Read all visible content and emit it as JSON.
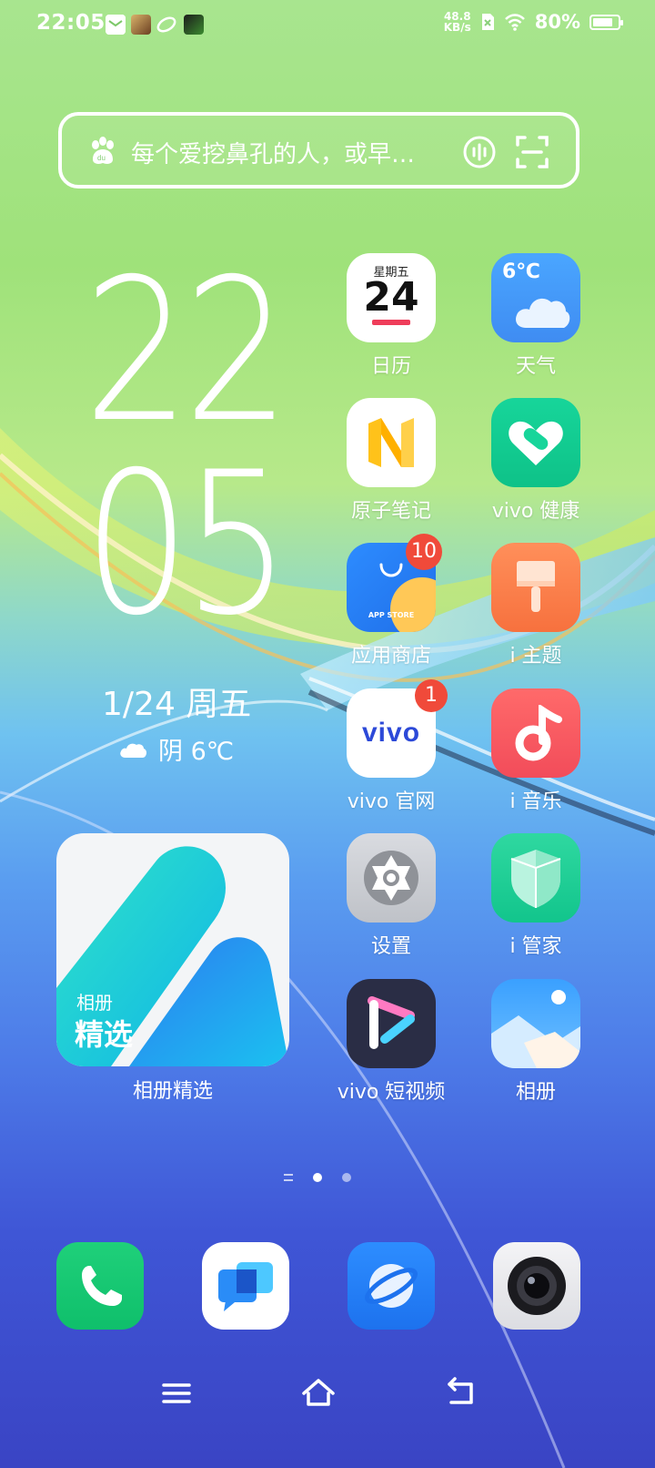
{
  "status_bar": {
    "time": "22:05",
    "net_speed_value": "48.8",
    "net_speed_unit": "KB/s",
    "battery_percent": "80%",
    "battery_level": 0.8
  },
  "search_bar": {
    "placeholder": "每个爱挖鼻孔的人，或早…"
  },
  "clock_widget": {
    "hour": "22",
    "minute": "05",
    "date": "1/24 周五",
    "weather": "阴 6℃"
  },
  "apps": [
    {
      "label": "日历",
      "icon": "calendar-icon",
      "cal_weekday": "星期五",
      "cal_day": "24"
    },
    {
      "label": "天气",
      "icon": "weather-icon",
      "temp": "6℃"
    },
    {
      "label": "原子笔记",
      "icon": "notes-icon"
    },
    {
      "label": "vivo 健康",
      "icon": "health-icon"
    },
    {
      "label": "应用商店",
      "icon": "app-store-icon",
      "badge": "10",
      "store_text": "APP STORE"
    },
    {
      "label": "i 主题",
      "icon": "theme-brush-icon"
    },
    {
      "label": "vivo 官网",
      "icon": "vivo-logo-icon",
      "badge": "1",
      "brand": "vivo"
    },
    {
      "label": "i 音乐",
      "icon": "music-note-icon"
    },
    {
      "label": "设置",
      "icon": "settings-gear-icon"
    },
    {
      "label": "i 管家",
      "icon": "shield-icon"
    },
    {
      "label": "vivo 短视频",
      "icon": "video-play-icon"
    },
    {
      "label": "相册",
      "icon": "gallery-icon"
    }
  ],
  "album_widget": {
    "line1": "相册",
    "line2": "精选",
    "label": "相册精选"
  },
  "page_indicator": {
    "pages": 2,
    "active": 0
  },
  "dock": [
    {
      "name": "phone-icon"
    },
    {
      "name": "messages-icon"
    },
    {
      "name": "browser-icon"
    },
    {
      "name": "camera-icon"
    }
  ],
  "nav": [
    "menu-icon",
    "home-icon",
    "back-icon"
  ]
}
